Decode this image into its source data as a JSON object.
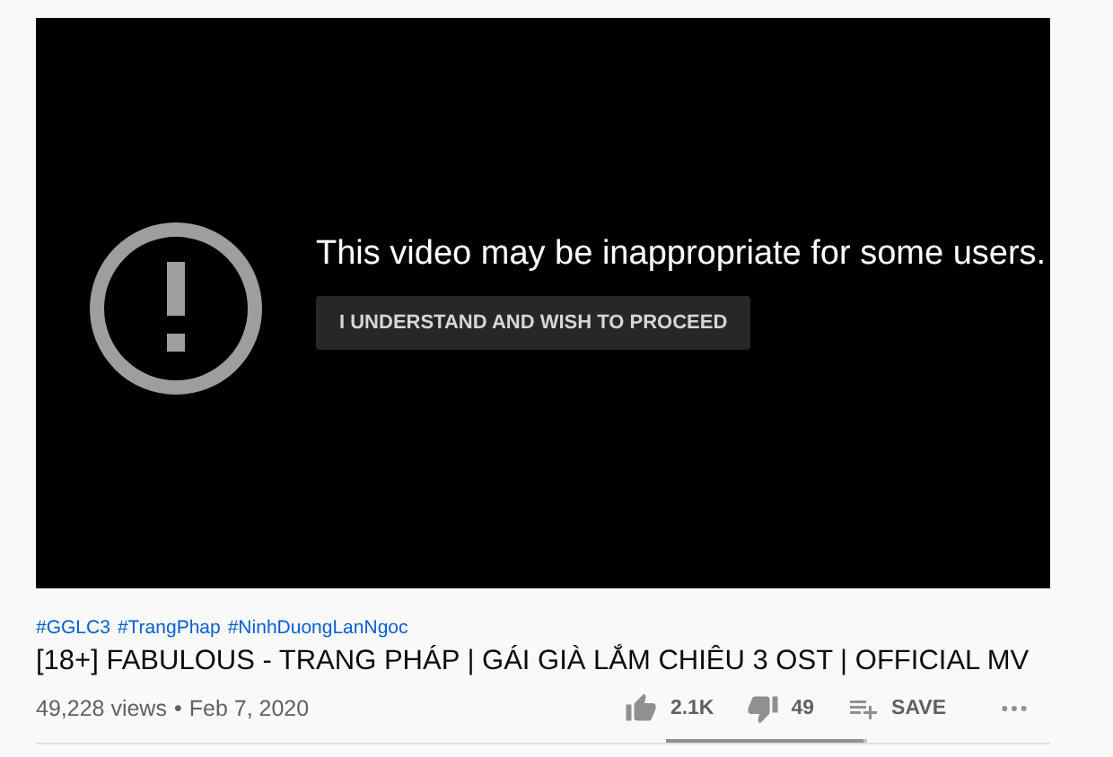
{
  "player": {
    "warning": "This video may be inappropriate for some users.",
    "button": "I UNDERSTAND AND WISH TO PROCEED"
  },
  "hashtags": [
    "#GGLC3",
    "#TrangPhap",
    "#NinhDuongLanNgoc"
  ],
  "title": "[18+] FABULOUS - TRANG PHÁP | GÁI GIÀ LẮM CHIÊU 3 OST | OFFICIAL MV",
  "meta": {
    "views": "49,228 views",
    "separator": "•",
    "date": "Feb 7, 2020"
  },
  "actions": [
    {
      "kind": "like",
      "label": "2.1K"
    },
    {
      "kind": "dislike",
      "label": "49"
    },
    {
      "kind": "save",
      "label": "SAVE"
    },
    {
      "kind": "more"
    }
  ],
  "sentiment": {
    "level": 0.98
  }
}
